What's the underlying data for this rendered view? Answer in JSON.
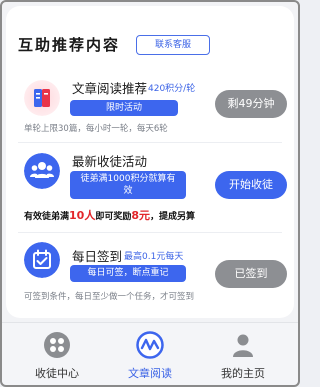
{
  "card": {
    "title": "互助推荐内容",
    "contact_button": "联系客服"
  },
  "tasks": [
    {
      "name": "文章阅读推荐",
      "reward": "420积分/轮",
      "pill": "限时活动",
      "button": "剩49分钟",
      "note": "单轮上限30篇，每小时一轮，每天6轮",
      "icon": "book-icon"
    },
    {
      "name": "最新收徒活动",
      "pill_line1": "徒弟满1000积分就算有",
      "pill_line2": "效",
      "button": "开始收徒",
      "warn_prefix": "有效徒弟满",
      "warn_count": "10人",
      "warn_middle": "即可奖励",
      "warn_amount": "8元",
      "warn_suffix": "，提成另算",
      "icon": "group-icon"
    },
    {
      "name": "每日签到",
      "reward": "最高0.1元每天",
      "pill": "每日可签，断点重记",
      "button": "已签到",
      "note": "可签到条件，每日至少做一个任务，才可签到",
      "icon": "calendar-icon"
    }
  ],
  "tabs": [
    {
      "label": "收徒中心",
      "icon": "apps-icon"
    },
    {
      "label": "文章阅读",
      "icon": "read-wave-icon"
    },
    {
      "label": "我的主页",
      "icon": "user-icon"
    }
  ],
  "colors": {
    "accent": "#3d66ee",
    "gray_button": "#8d8f93",
    "highlight": "#e2262a"
  }
}
